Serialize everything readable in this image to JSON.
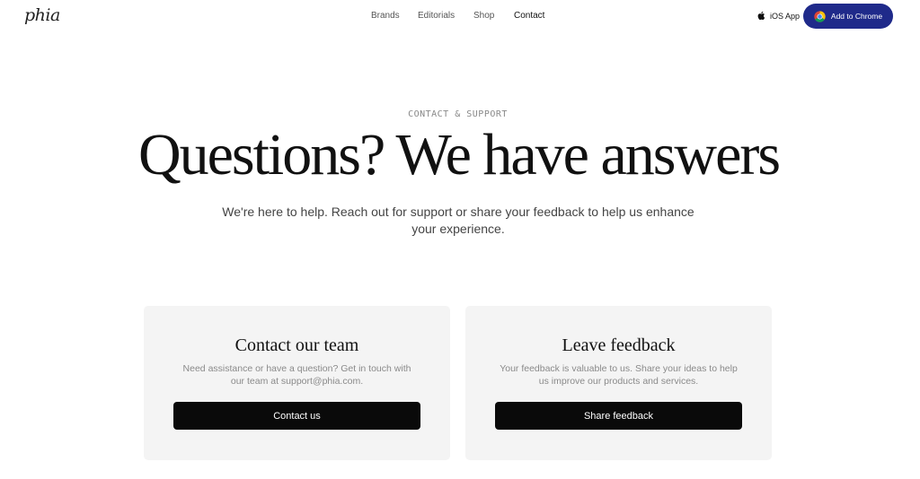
{
  "header": {
    "logo": "phia",
    "nav": [
      {
        "label": "Brands"
      },
      {
        "label": "Editorials"
      },
      {
        "label": "Shop"
      },
      {
        "label": "Contact"
      }
    ],
    "ios_label": "iOS App",
    "chrome_button": "Add to Chrome"
  },
  "hero": {
    "eyebrow": "CONTACT & SUPPORT",
    "headline": "Questions? We have answers",
    "subhead": "We're here to help. Reach out for support or share your feedback to help us enhance your experience."
  },
  "cards": [
    {
      "title": "Contact our team",
      "description": "Need assistance or have a question? Get in touch with our team at support@phia.com.",
      "button": "Contact us"
    },
    {
      "title": "Leave feedback",
      "description": "Your feedback is valuable to us. Share your ideas to help us improve our products and services.",
      "button": "Share feedback"
    }
  ],
  "colors": {
    "chrome_button_bg": "#1f2a8a",
    "card_bg": "#f4f4f4",
    "card_button_bg": "#0a0a0a"
  },
  "icons": {
    "apple": "apple-icon",
    "chrome": "chrome-icon"
  }
}
